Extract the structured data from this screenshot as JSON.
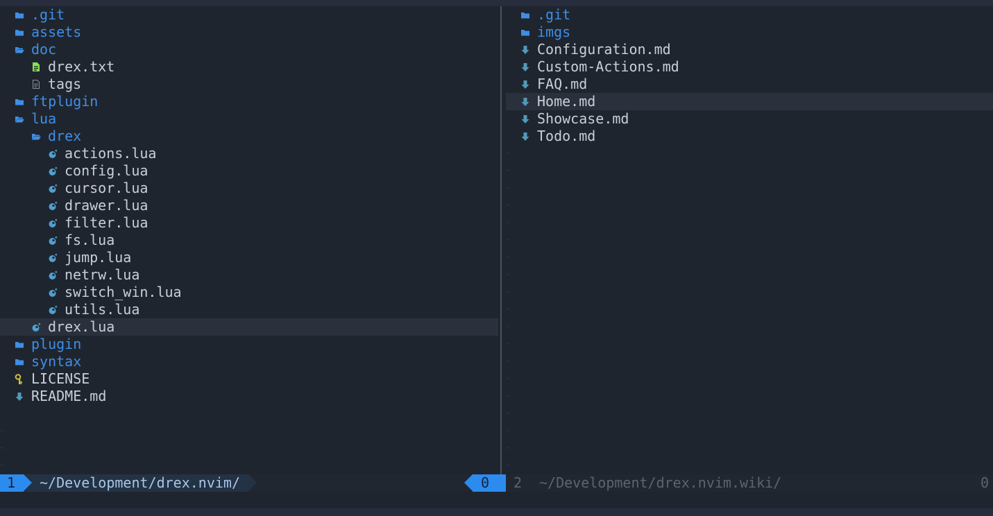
{
  "left_pane": {
    "cursor_index": 18,
    "rows": [
      {
        "name": ".git",
        "type": "dir",
        "open": false,
        "depth": 0
      },
      {
        "name": "assets",
        "type": "dir",
        "open": false,
        "depth": 0
      },
      {
        "name": "doc",
        "type": "dir",
        "open": true,
        "depth": 0
      },
      {
        "name": "drex.txt",
        "type": "file",
        "icon": "text-file-icon",
        "depth": 1
      },
      {
        "name": "tags",
        "type": "file",
        "icon": "plain-file-icon",
        "depth": 1
      },
      {
        "name": "ftplugin",
        "type": "dir",
        "open": false,
        "depth": 0
      },
      {
        "name": "lua",
        "type": "dir",
        "open": true,
        "depth": 0
      },
      {
        "name": "drex",
        "type": "dir",
        "open": true,
        "depth": 1
      },
      {
        "name": "actions.lua",
        "type": "file",
        "icon": "lua-icon",
        "depth": 2
      },
      {
        "name": "config.lua",
        "type": "file",
        "icon": "lua-icon",
        "depth": 2
      },
      {
        "name": "cursor.lua",
        "type": "file",
        "icon": "lua-icon",
        "depth": 2
      },
      {
        "name": "drawer.lua",
        "type": "file",
        "icon": "lua-icon",
        "depth": 2
      },
      {
        "name": "filter.lua",
        "type": "file",
        "icon": "lua-icon",
        "depth": 2
      },
      {
        "name": "fs.lua",
        "type": "file",
        "icon": "lua-icon",
        "depth": 2
      },
      {
        "name": "jump.lua",
        "type": "file",
        "icon": "lua-icon",
        "depth": 2
      },
      {
        "name": "netrw.lua",
        "type": "file",
        "icon": "lua-icon",
        "depth": 2
      },
      {
        "name": "switch_win.lua",
        "type": "file",
        "icon": "lua-icon",
        "depth": 2
      },
      {
        "name": "utils.lua",
        "type": "file",
        "icon": "lua-icon",
        "depth": 2
      },
      {
        "name": "drex.lua",
        "type": "file",
        "icon": "lua-icon",
        "depth": 1
      },
      {
        "name": "plugin",
        "type": "dir",
        "open": false,
        "depth": 0
      },
      {
        "name": "syntax",
        "type": "dir",
        "open": false,
        "depth": 0
      },
      {
        "name": "LICENSE",
        "type": "file",
        "icon": "license-key-icon",
        "depth": 0
      },
      {
        "name": "README.md",
        "type": "file",
        "icon": "markdown-icon",
        "depth": 0
      }
    ]
  },
  "right_pane": {
    "cursor_index": 5,
    "rows": [
      {
        "name": ".git",
        "type": "dir",
        "open": false,
        "depth": 0
      },
      {
        "name": "imgs",
        "type": "dir",
        "open": false,
        "depth": 0
      },
      {
        "name": "Configuration.md",
        "type": "file",
        "icon": "markdown-icon",
        "depth": 0
      },
      {
        "name": "Custom-Actions.md",
        "type": "file",
        "icon": "markdown-icon",
        "depth": 0
      },
      {
        "name": "FAQ.md",
        "type": "file",
        "icon": "markdown-icon",
        "depth": 0
      },
      {
        "name": "Home.md",
        "type": "file",
        "icon": "markdown-icon",
        "depth": 0
      },
      {
        "name": "Showcase.md",
        "type": "file",
        "icon": "markdown-icon",
        "depth": 0
      },
      {
        "name": "Todo.md",
        "type": "file",
        "icon": "markdown-icon",
        "depth": 0
      }
    ]
  },
  "statusline": {
    "left_window_number": "1",
    "left_path": "~/Development/drex.nvim/",
    "left_count": "0",
    "right_window_number": "2",
    "right_path": "~/Development/drex.nvim.wiki/",
    "right_count": "0"
  },
  "colors": {
    "background": "#1f252e",
    "directory": "#3f8ee6",
    "file_text": "#c9cfd8",
    "lua_icon": "#51a0cf",
    "markdown_icon": "#519aba",
    "text_file_icon": "#89e051",
    "license_icon": "#d0bf41",
    "accent": "#2c8bef",
    "cursor_line": "#2a313c"
  }
}
